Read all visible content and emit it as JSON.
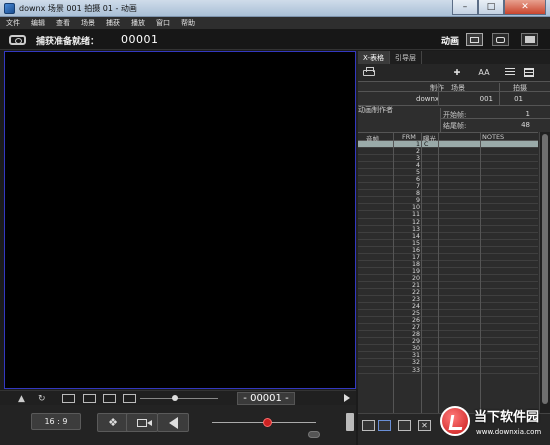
{
  "window": {
    "title": "downx 场景 001 拍摄 01 - 动画",
    "controls": [
      "minimize",
      "maximize",
      "close"
    ]
  },
  "menu": [
    "文件",
    "编辑",
    "查看",
    "场景",
    "捕获",
    "播放",
    "窗口",
    "帮助"
  ],
  "toolbar": {
    "status_label": "捕获准备就绪：",
    "frame_number": "00001",
    "mode_label": "动画"
  },
  "viewer": {
    "counter": "- 00001 -",
    "aspect_ratio": "16 : 9"
  },
  "xsheet": {
    "tabs": [
      "X-表格",
      "引导层"
    ],
    "active_tab": "X-表格",
    "text_size_label": "AA",
    "info": {
      "production_label": "制作",
      "scene_label": "场景",
      "take_label": "拍摄",
      "production_value": "downx",
      "scene_value": "001",
      "take_value": "01",
      "animator_label": "动画制作者",
      "start_frame_label": "开始帧:",
      "start_frame_value": "1",
      "end_frame_label": "结尾帧:",
      "end_frame_value": "48"
    },
    "columns": {
      "sound": "音帧",
      "frm": "FRM",
      "exposure": "曝光",
      "notes": "NOTES"
    },
    "rows": [
      {
        "frm": "1",
        "exposure": "C",
        "selected": true
      },
      {
        "frm": "2"
      },
      {
        "frm": "3"
      },
      {
        "frm": "4"
      },
      {
        "frm": "5"
      },
      {
        "frm": "6"
      },
      {
        "frm": "7"
      },
      {
        "frm": "8"
      },
      {
        "frm": "9"
      },
      {
        "frm": "10"
      },
      {
        "frm": "11"
      },
      {
        "frm": "12"
      },
      {
        "frm": "13"
      },
      {
        "frm": "14"
      },
      {
        "frm": "15"
      },
      {
        "frm": "16"
      },
      {
        "frm": "17"
      },
      {
        "frm": "18"
      },
      {
        "frm": "19"
      },
      {
        "frm": "20"
      },
      {
        "frm": "21"
      },
      {
        "frm": "22"
      },
      {
        "frm": "23"
      },
      {
        "frm": "24"
      },
      {
        "frm": "25"
      },
      {
        "frm": "26"
      },
      {
        "frm": "27"
      },
      {
        "frm": "28"
      },
      {
        "frm": "29"
      },
      {
        "frm": "30"
      },
      {
        "frm": "31"
      },
      {
        "frm": "32"
      },
      {
        "frm": "33"
      }
    ]
  },
  "watermark": {
    "title": "当下软件园",
    "url": "www.downxia.com"
  },
  "colors": {
    "selection_row": "#9aaaa9",
    "viewer_border": "#3338c0",
    "onion_knob": "#cc2222"
  }
}
